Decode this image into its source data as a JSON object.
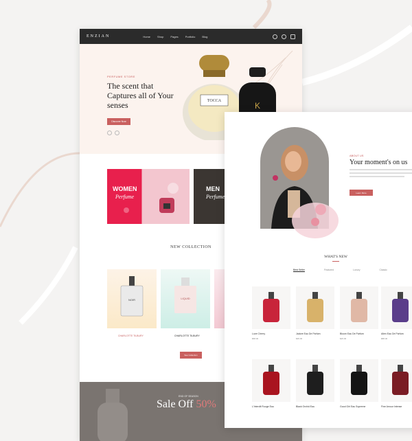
{
  "left": {
    "logo": "ENZIAN",
    "nav": [
      "Home",
      "Shop",
      "Pages",
      "Portfolio",
      "Blog"
    ],
    "hero": {
      "tag": "PERFUME STORE",
      "title": "The scent that Captures all of Your senses",
      "button": "Discover Now",
      "bottle_label": "TOCCA"
    },
    "categories": [
      {
        "title": "WOMEN",
        "subtitle": "Perfume"
      },
      {
        "title": "MEN",
        "subtitle": "Perfume"
      }
    ],
    "collection_title": "NEW COLLECTION",
    "collection": [
      {
        "label": "CHARLOTTE TILBURY",
        "bottle_label": "NOIR"
      },
      {
        "label": "CHARLOTTE TILBURY",
        "bottle_label": "LIQUID"
      }
    ],
    "collection_button": "See Collection",
    "sale": {
      "kicker": "END OF SEASON",
      "title": "Sale Off",
      "percent": "50%"
    }
  },
  "right": {
    "about_tag": "ABOUT US",
    "about_title": "Your moment's on us",
    "about_button": "Learn More",
    "whats_new": "WHAT'S NEW",
    "tabs": [
      "Best Seller",
      "Featured",
      "Luxury",
      "Classic"
    ],
    "products_row1": [
      {
        "name": "Love Cherry",
        "price": "$58.00",
        "color": "#c8243a"
      },
      {
        "name": "Jadore Eau De Parfum",
        "price": "$35.00",
        "color": "#d8b26a"
      },
      {
        "name": "Bloom Eau De Parfum",
        "price": "$25.00",
        "color": "#e0b8a6"
      },
      {
        "name": "Alien Eau De Parfum",
        "price": "$88.00",
        "color": "#5a3d8a"
      }
    ],
    "products_row2": [
      {
        "name": "L'Interdit Rouge Eau",
        "price": "",
        "color": "#a9141f"
      },
      {
        "name": "Black Orchid Eau",
        "price": "",
        "color": "#1e1e1e"
      },
      {
        "name": "Good Girl Eau Supreme",
        "price": "",
        "color": "#141414"
      },
      {
        "name": "Fine Amour Intense",
        "price": "",
        "color": "#7a1c24"
      }
    ]
  },
  "colors": {
    "accent": "#c9605f",
    "nav": "#2b2b2b",
    "hero_bg": "#fcf3ee"
  }
}
